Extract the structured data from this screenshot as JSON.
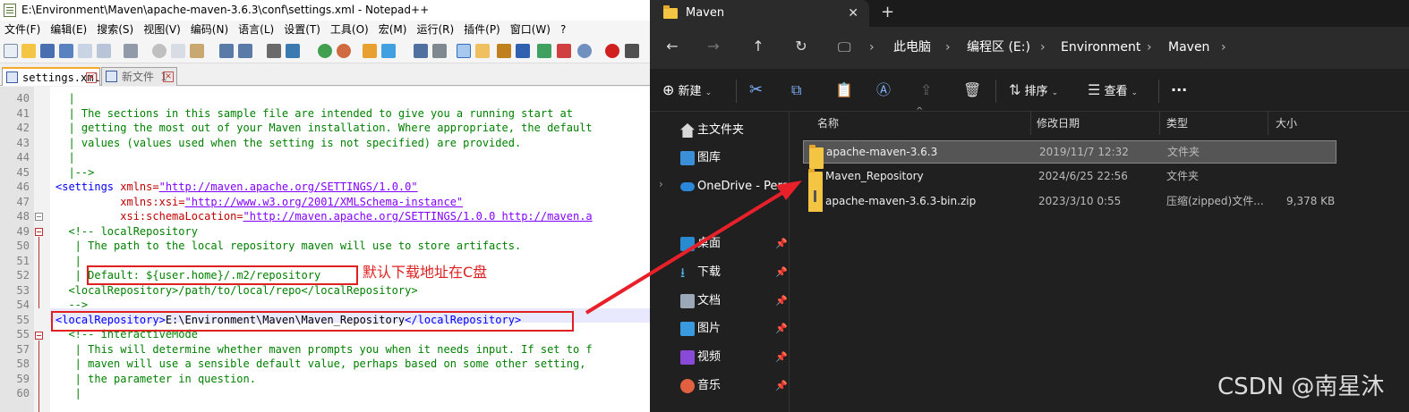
{
  "npp": {
    "title": "E:\\Environment\\Maven\\apache-maven-3.6.3\\conf\\settings.xml - Notepad++",
    "menu": [
      "文件(F)",
      "编辑(E)",
      "搜索(S)",
      "视图(V)",
      "编码(N)",
      "语言(L)",
      "设置(T)",
      "工具(O)",
      "宏(M)",
      "运行(R)",
      "插件(P)",
      "窗口(W)",
      "?"
    ],
    "tabs": [
      {
        "label": "settings.xml",
        "active": true
      },
      {
        "label": "新文件 1",
        "active": false
      }
    ],
    "lines": [
      {
        "n": "40",
        "text": "  |"
      },
      {
        "n": "41",
        "text": "  | The sections in this sample file are intended to give you a running start at"
      },
      {
        "n": "42",
        "text": "  | getting the most out of your Maven installation. Where appropriate, the default"
      },
      {
        "n": "43",
        "text": "  | values (values used when the setting is not specified) are provided."
      },
      {
        "n": "44",
        "text": "  |"
      },
      {
        "n": "45",
        "text": "  |-->"
      },
      {
        "n": "46",
        "tag_open": "<settings",
        "attr": " xmlns=",
        "value": "\"http://maven.apache.org/SETTINGS/1.0.0\""
      },
      {
        "n": "47",
        "indent": "          ",
        "attr": "xmlns:xsi=",
        "value": "\"http://www.w3.org/2001/XMLSchema-instance\""
      },
      {
        "n": "48",
        "indent": "          ",
        "attr": "xsi:schemaLocation=",
        "value": "\"http://maven.apache.org/SETTINGS/1.0.0 http://maven.a"
      },
      {
        "n": "49",
        "text": "  <!-- localRepository"
      },
      {
        "n": "50",
        "text": "   | The path to the local repository maven will use to store artifacts."
      },
      {
        "n": "51",
        "text": "   |"
      },
      {
        "n": "52",
        "text": "   | Default: ${user.home}/.m2/repository"
      },
      {
        "n": "53",
        "text": "  <localRepository>/path/to/local/repo</localRepository>"
      },
      {
        "n": "54",
        "text": "  -->"
      },
      {
        "n": "55",
        "tag_open": "<localRepository>",
        "content": "E:\\Environment\\Maven\\Maven_Repository",
        "tag_close": "</localRepository>"
      },
      {
        "n": "55",
        "text": "  <!-- interactiveMode"
      },
      {
        "n": "57",
        "text": "   | This will determine whether maven prompts you when it needs input. If set to f"
      },
      {
        "n": "58",
        "text": "   | maven will use a sensible default value, perhaps based on some other setting,"
      },
      {
        "n": "59",
        "text": "   | the parameter in question."
      },
      {
        "n": "60",
        "text": "   |"
      }
    ],
    "annotation": "默认下载地址在C盘"
  },
  "explorer": {
    "tab_title": "Maven",
    "tab_close": "✕",
    "new_tab": "+",
    "breadcrumb": [
      "此电脑",
      "编程区 (E:)",
      "Environment",
      "Maven"
    ],
    "commands": {
      "new": "新建",
      "sort": "排序",
      "view": "查看",
      "more": "···"
    },
    "sidebar": {
      "home": "主文件夹",
      "gallery": "图库",
      "onedrive": "OneDrive - Perso",
      "desktop": "桌面",
      "downloads": "下载",
      "documents": "文档",
      "pictures": "图片",
      "videos": "视频",
      "music": "音乐"
    },
    "columns": {
      "name": "名称",
      "modified": "修改日期",
      "type": "类型",
      "size": "大小"
    },
    "files": [
      {
        "name": "apache-maven-3.6.3",
        "modified": "2019/11/7 12:32",
        "type": "文件夹",
        "size": "",
        "kind": "folder",
        "selected": true
      },
      {
        "name": "Maven_Repository",
        "modified": "2024/6/25 22:56",
        "type": "文件夹",
        "size": "",
        "kind": "folder",
        "selected": false
      },
      {
        "name": "apache-maven-3.6.3-bin.zip",
        "modified": "2023/3/10 0:55",
        "type": "压缩(zipped)文件...",
        "size": "9,378 KB",
        "kind": "zip",
        "selected": false
      }
    ]
  },
  "watermark": "CSDN @南星沐",
  "colors": {
    "annotation_red": "#e02020",
    "arrow_red": "#e8202a",
    "explorer_bg": "#202020"
  }
}
